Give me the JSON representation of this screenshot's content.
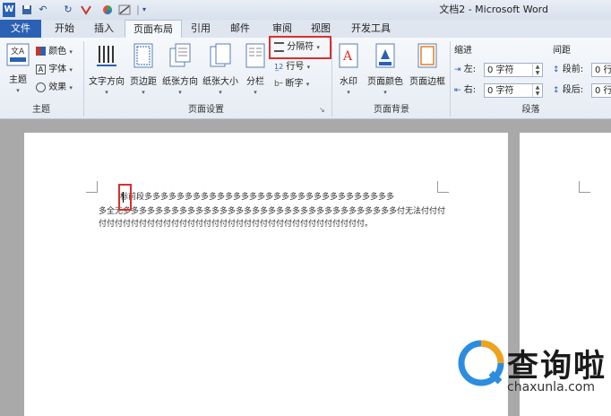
{
  "window": {
    "title": "文档2 - Microsoft Word"
  },
  "qat": {
    "word_icon": "W",
    "undo": "↶",
    "redo": "↻",
    "sep": "|"
  },
  "tabs": [
    {
      "label": "文件"
    },
    {
      "label": "开始"
    },
    {
      "label": "插入"
    },
    {
      "label": "页面布局"
    },
    {
      "label": "引用"
    },
    {
      "label": "邮件"
    },
    {
      "label": "审阅"
    },
    {
      "label": "视图"
    },
    {
      "label": "开发工具"
    }
  ],
  "theme_group": {
    "label": "主题",
    "themes": "主题",
    "colors": "颜色",
    "fonts": "字体",
    "effects": "效果"
  },
  "page_setup": {
    "label": "页面设置",
    "text_direction": "文字方向",
    "margins": "页边距",
    "orientation": "纸张方向",
    "size": "纸张大小",
    "columns": "分栏",
    "breaks": "分隔符",
    "line_numbers": "行号",
    "hyphenation": "断字"
  },
  "page_background": {
    "label": "页面背景",
    "watermark": "水印",
    "page_color": "页面颜色",
    "page_borders": "页面边框"
  },
  "paragraph": {
    "label": "段落",
    "indent_title": "缩进",
    "spacing_title": "间距",
    "left_label": "左:",
    "left_value": "0 字符",
    "right_label": "右:",
    "right_value": "0 字符",
    "before_label": "段前:",
    "before_value": "0 行",
    "after_label": "段后:",
    "after_value": "0 行"
  },
  "document": {
    "line1": "标前段多多多多多多多多多多多多多多多多多多多多多多多多多多多多多多多",
    "line2": "多全无多多多多多多多多多多多多多多多多多多多多多多多多多多多多多多多多多多付无法付付付",
    "line3": "付付付付付付付付付付付付付付付付付付付付付付付付付付付付付付付付付。"
  },
  "watermark": {
    "title": "查询啦",
    "url": "chaxunla.com"
  },
  "colors": {
    "accent": "#2b61b4",
    "highlight": "#d9302c"
  }
}
